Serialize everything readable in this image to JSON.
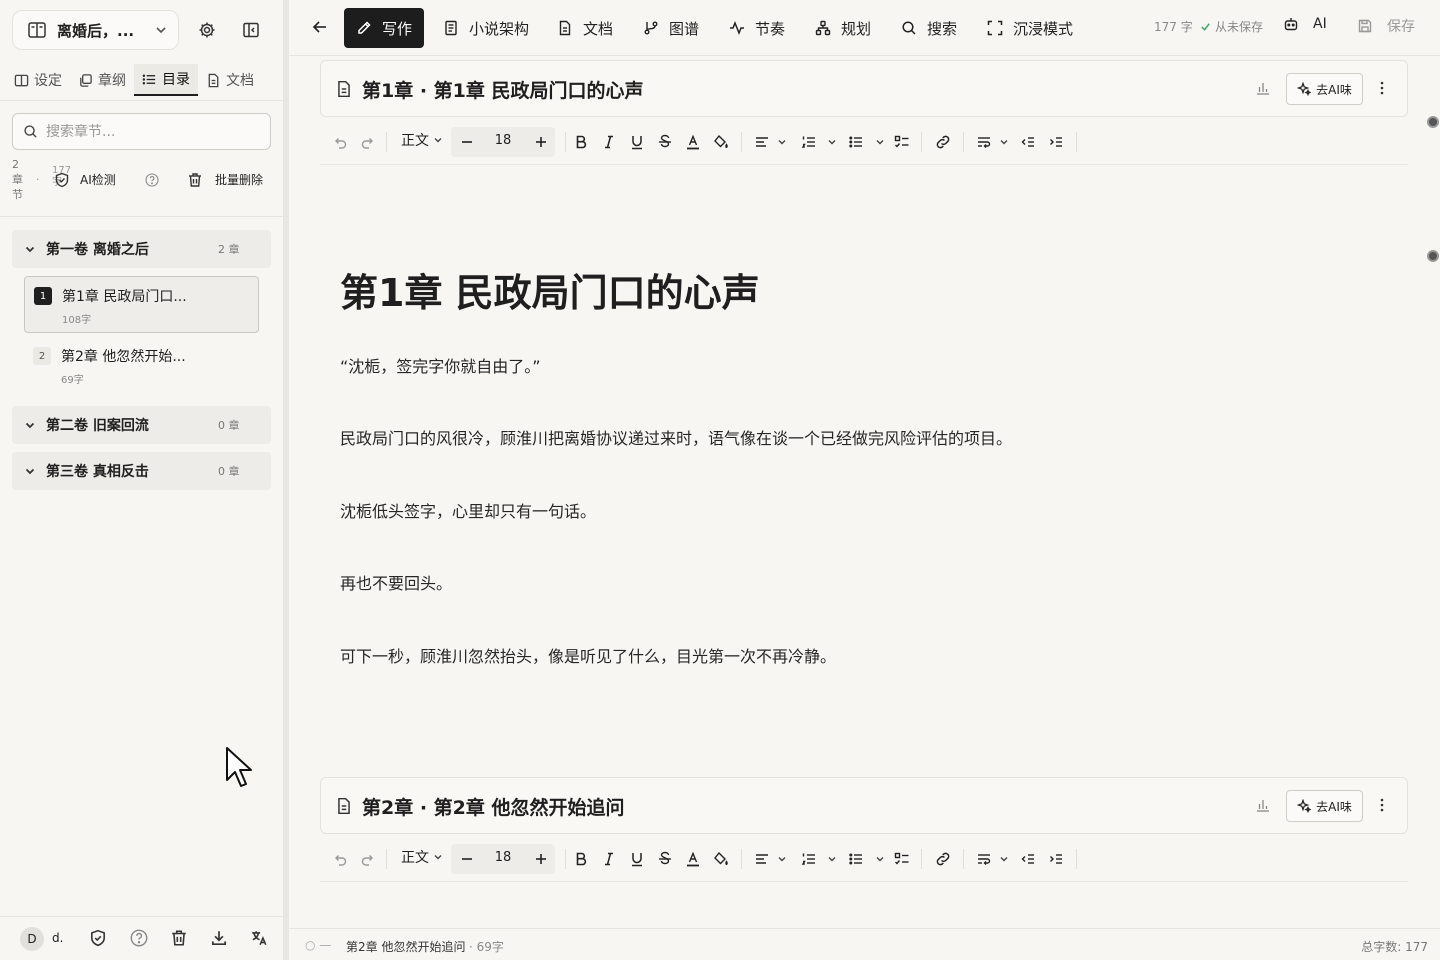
{
  "sidebar": {
    "project_name": "离婚后，...",
    "tabs": [
      {
        "label": "设定",
        "icon": "book-icon"
      },
      {
        "label": "章纲",
        "icon": "layers-icon"
      },
      {
        "label": "目录",
        "icon": "list-icon"
      },
      {
        "label": "文档",
        "icon": "document-icon"
      }
    ],
    "active_tab": "目录",
    "search_placeholder": "搜索章节...",
    "stats": {
      "chapters": "2 章 节",
      "separator": "·",
      "words": "177 字"
    },
    "ai_detect_label": "AI检测",
    "batch_delete_label": "批量删除",
    "volumes": [
      {
        "title": "第一卷 离婚之后",
        "count": "2 章"
      },
      {
        "title": "第二卷 旧案回流",
        "count": "0 章"
      },
      {
        "title": "第三卷 真相反击",
        "count": "0 章"
      }
    ],
    "chapters": [
      {
        "num": "1",
        "title": "第1章 民政局门口...",
        "words": "108字",
        "active": true
      },
      {
        "num": "2",
        "title": "第2章 他忽然开始...",
        "words": "69字",
        "active": false
      }
    ],
    "footer": {
      "avatar": "D",
      "username": "d."
    }
  },
  "toolbar": {
    "nav": [
      {
        "label": "写作",
        "icon": "pen-icon"
      },
      {
        "label": "小说架构",
        "icon": "notebook-icon"
      },
      {
        "label": "文档",
        "icon": "document-icon"
      },
      {
        "label": "图谱",
        "icon": "graph-icon"
      },
      {
        "label": "节奏",
        "icon": "pulse-icon"
      },
      {
        "label": "规划",
        "icon": "hierarchy-icon"
      },
      {
        "label": "搜索",
        "icon": "search-icon"
      },
      {
        "label": "沉浸模式",
        "icon": "fullscreen-icon"
      }
    ],
    "active": "写作",
    "word_count": "177 字",
    "save_status": "从未保存",
    "ai_label": "AI",
    "save_label": "保存"
  },
  "editor": {
    "paragraph_style": "正文",
    "font_size": "18",
    "deai_label": "去AI味",
    "chapters": [
      {
        "header": "第1章 · 第1章 民政局门口的心声",
        "title": "第1章 民政局门口的心声",
        "paragraphs": [
          "“沈栀，签完字你就自由了。”",
          "民政局门口的风很冷，顾淮川把离婚协议递过来时，语气像在谈一个已经做完风险评估的项目。",
          "沈栀低头签字，心里却只有一句话。",
          "再也不要回头。",
          "可下一秒，顾淮川忽然抬头，像是听见了什么，目光第一次不再冷静。"
        ]
      },
      {
        "header": "第2章 · 第2章 他忽然开始追问"
      }
    ]
  },
  "statusbar": {
    "icon_text": "○ —",
    "chapter": "第2章 他忽然开始追问",
    "separator": "·",
    "words": "69字",
    "total": "总字数: 177"
  }
}
